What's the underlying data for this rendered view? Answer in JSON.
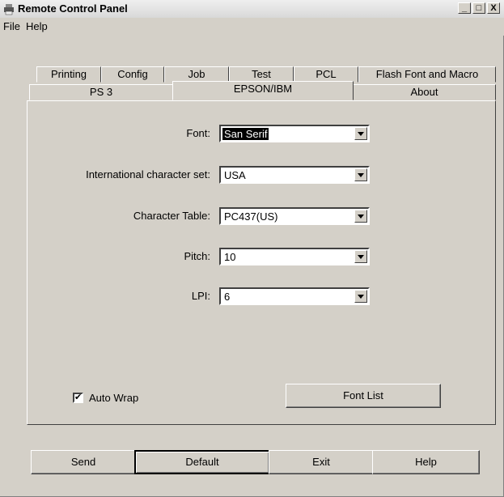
{
  "window": {
    "title": "Remote Control Panel",
    "buttons": {
      "minimize": "_",
      "maximize": "□",
      "close": "X"
    }
  },
  "menu": {
    "items": [
      "File",
      "Help"
    ]
  },
  "tabs": {
    "row_back": [
      "Printing",
      "Config",
      "Job",
      "Test",
      "PCL",
      "Flash Font and Macro"
    ],
    "row_front": [
      "PS 3",
      "EPSON/IBM",
      "About"
    ],
    "active": "EPSON/IBM"
  },
  "fields": [
    {
      "label": "Font:",
      "value": "San Serif"
    },
    {
      "label": "International character set:",
      "value": "USA"
    },
    {
      "label": "Character Table:",
      "value": "PC437(US)"
    },
    {
      "label": "Pitch:",
      "value": "10"
    },
    {
      "label": "LPI:",
      "value": "6"
    }
  ],
  "auto_wrap": {
    "label": "Auto Wrap",
    "checked": true
  },
  "font_list_button": "Font List",
  "bottom_buttons": {
    "send": "Send",
    "default": "Default",
    "exit": "Exit",
    "help": "Help"
  }
}
